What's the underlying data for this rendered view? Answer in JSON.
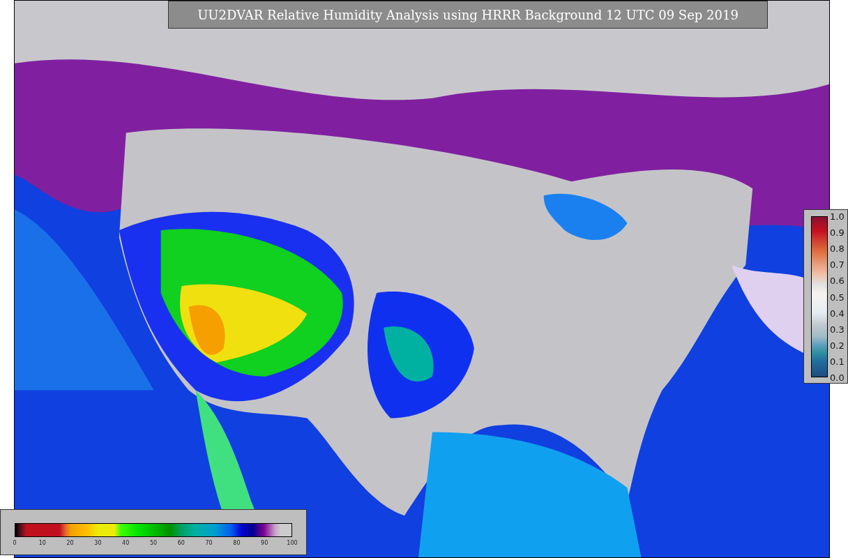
{
  "title": "UU2DVAR Relative Humidity Analysis using HRRR Background 12 UTC 09 Sep 2019",
  "humidity_colorbar": {
    "ticks": [
      "0",
      "10",
      "20",
      "30",
      "40",
      "50",
      "60",
      "70",
      "80",
      "90",
      "100"
    ]
  },
  "ratio_colorbar": {
    "ticks": [
      "1.0",
      "0.9",
      "0.8",
      "0.7",
      "0.6",
      "0.5",
      "0.4",
      "0.3",
      "0.2",
      "0.1",
      "0.0"
    ]
  }
}
